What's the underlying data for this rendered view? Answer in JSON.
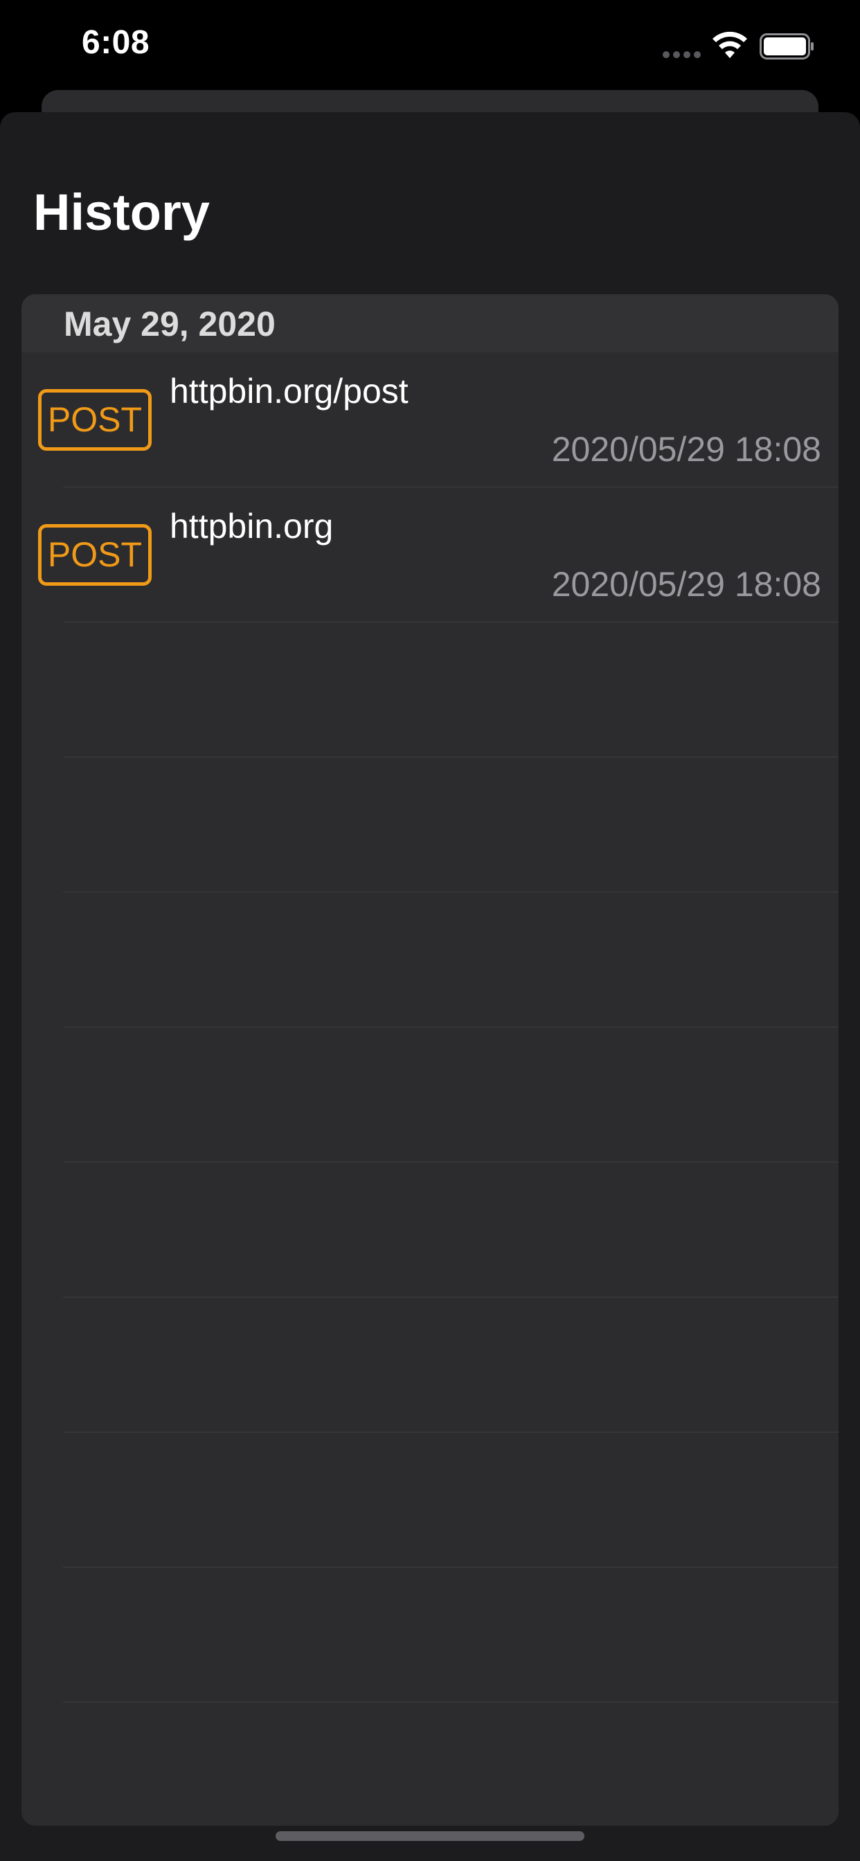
{
  "status_bar": {
    "time": "6:08"
  },
  "header": {
    "title": "History"
  },
  "history": {
    "sections": [
      {
        "date": "May 29, 2020",
        "items": [
          {
            "method": "POST",
            "url": "httpbin.org/post",
            "timestamp": "2020/05/29 18:08"
          },
          {
            "method": "POST",
            "url": "httpbin.org",
            "timestamp": "2020/05/29 18:08"
          }
        ]
      }
    ]
  },
  "colors": {
    "method_post": "#f19a18",
    "background": "#1c1c1e",
    "cell": "#2c2c2e"
  },
  "icons": [
    "cellular-signal-icon",
    "wifi-icon",
    "battery-icon"
  ]
}
